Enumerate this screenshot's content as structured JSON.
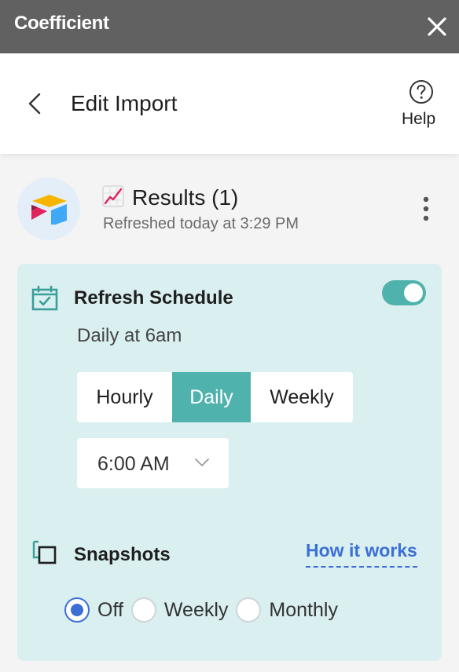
{
  "titlebar": {
    "app_name": "Coefficient"
  },
  "header": {
    "title": "Edit Import",
    "help_label": "Help"
  },
  "import": {
    "title": "Results (1)",
    "icon": "chart-increasing-emoji",
    "refreshed": "Refreshed today at 3:29 PM"
  },
  "schedule": {
    "title": "Refresh Schedule",
    "enabled": true,
    "description": "Daily at 6am",
    "frequency_options": [
      "Hourly",
      "Daily",
      "Weekly"
    ],
    "selected_frequency": "Daily",
    "time_value": "6:00 AM"
  },
  "snapshots": {
    "title": "Snapshots",
    "link_label": "How it works",
    "options": [
      "Off",
      "Weekly",
      "Monthly"
    ],
    "selected": "Off"
  },
  "colors": {
    "accent_teal": "#4fb2ad",
    "link_blue": "#3b6fd6",
    "card_bg": "#daeff0",
    "titlebar_bg": "#616161"
  }
}
